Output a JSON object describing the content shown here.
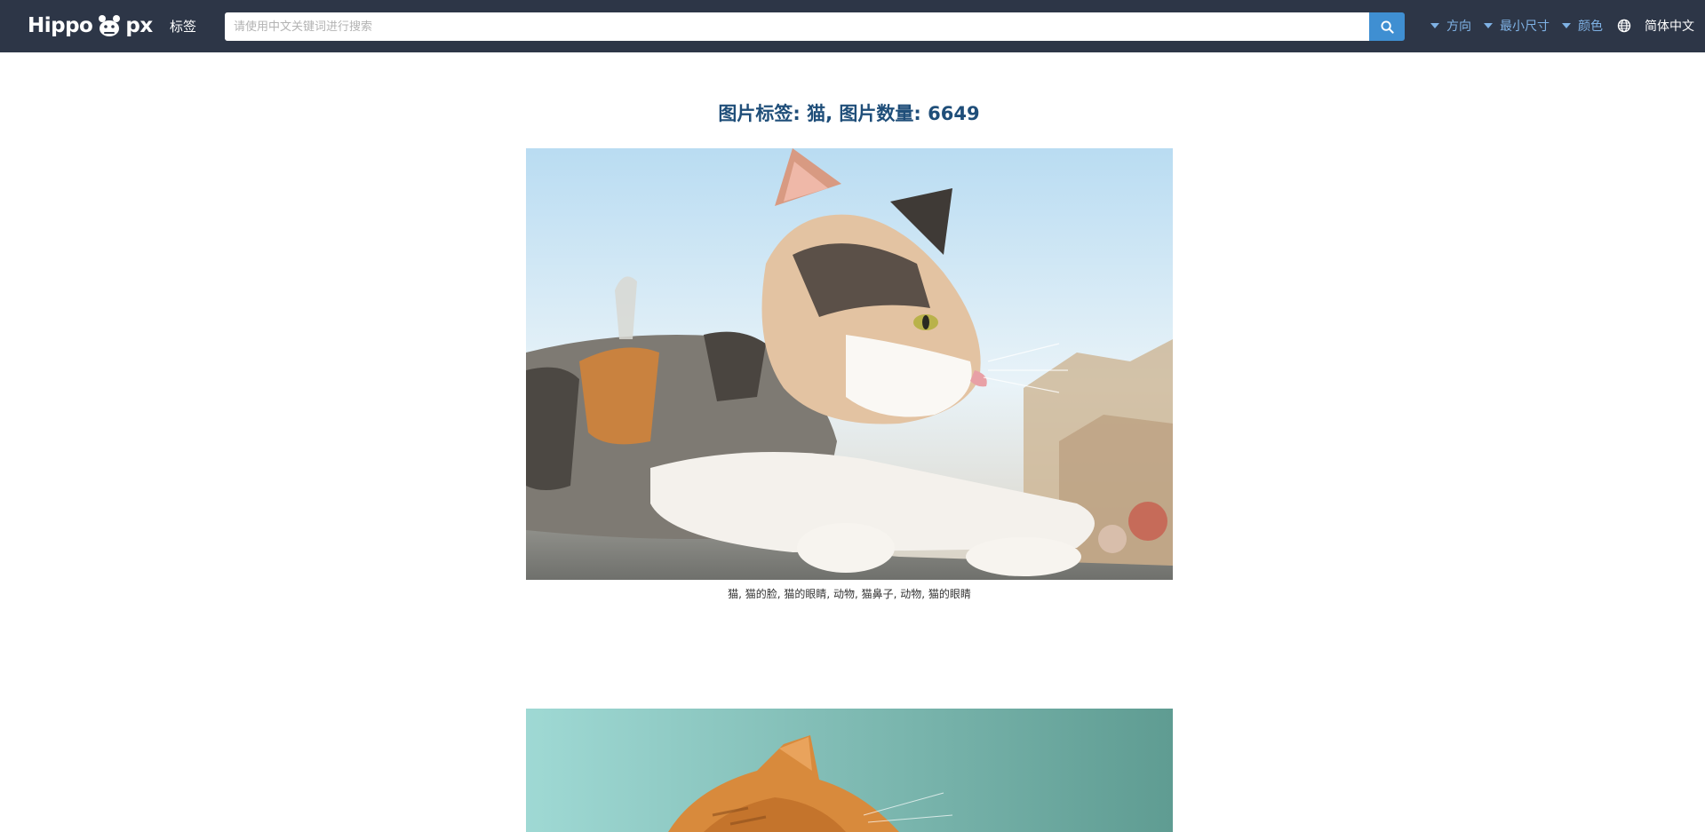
{
  "header": {
    "brand_left": "Hippo",
    "brand_right": "px",
    "nav_tags": "标签",
    "search_placeholder": "请使用中文关键词进行搜索",
    "filters": {
      "orientation": "方向",
      "min_size": "最小尺寸",
      "color": "颜色"
    },
    "language": "简体中文"
  },
  "main": {
    "heading": "图片标签: 猫, 图片数量: 6649",
    "results": [
      {
        "caption": "猫, 猫的脸, 猫的眼睛, 动物, 猫鼻子, 动物, 猫的眼睛"
      }
    ]
  },
  "colors": {
    "navbar_bg": "#2d3647",
    "search_button": "#3f8fd2",
    "filter_text": "#7fb2e5",
    "heading_text": "#1f4e79"
  },
  "icons": {
    "search": "search-icon",
    "globe": "globe-icon",
    "caret": "caret-down-icon"
  }
}
